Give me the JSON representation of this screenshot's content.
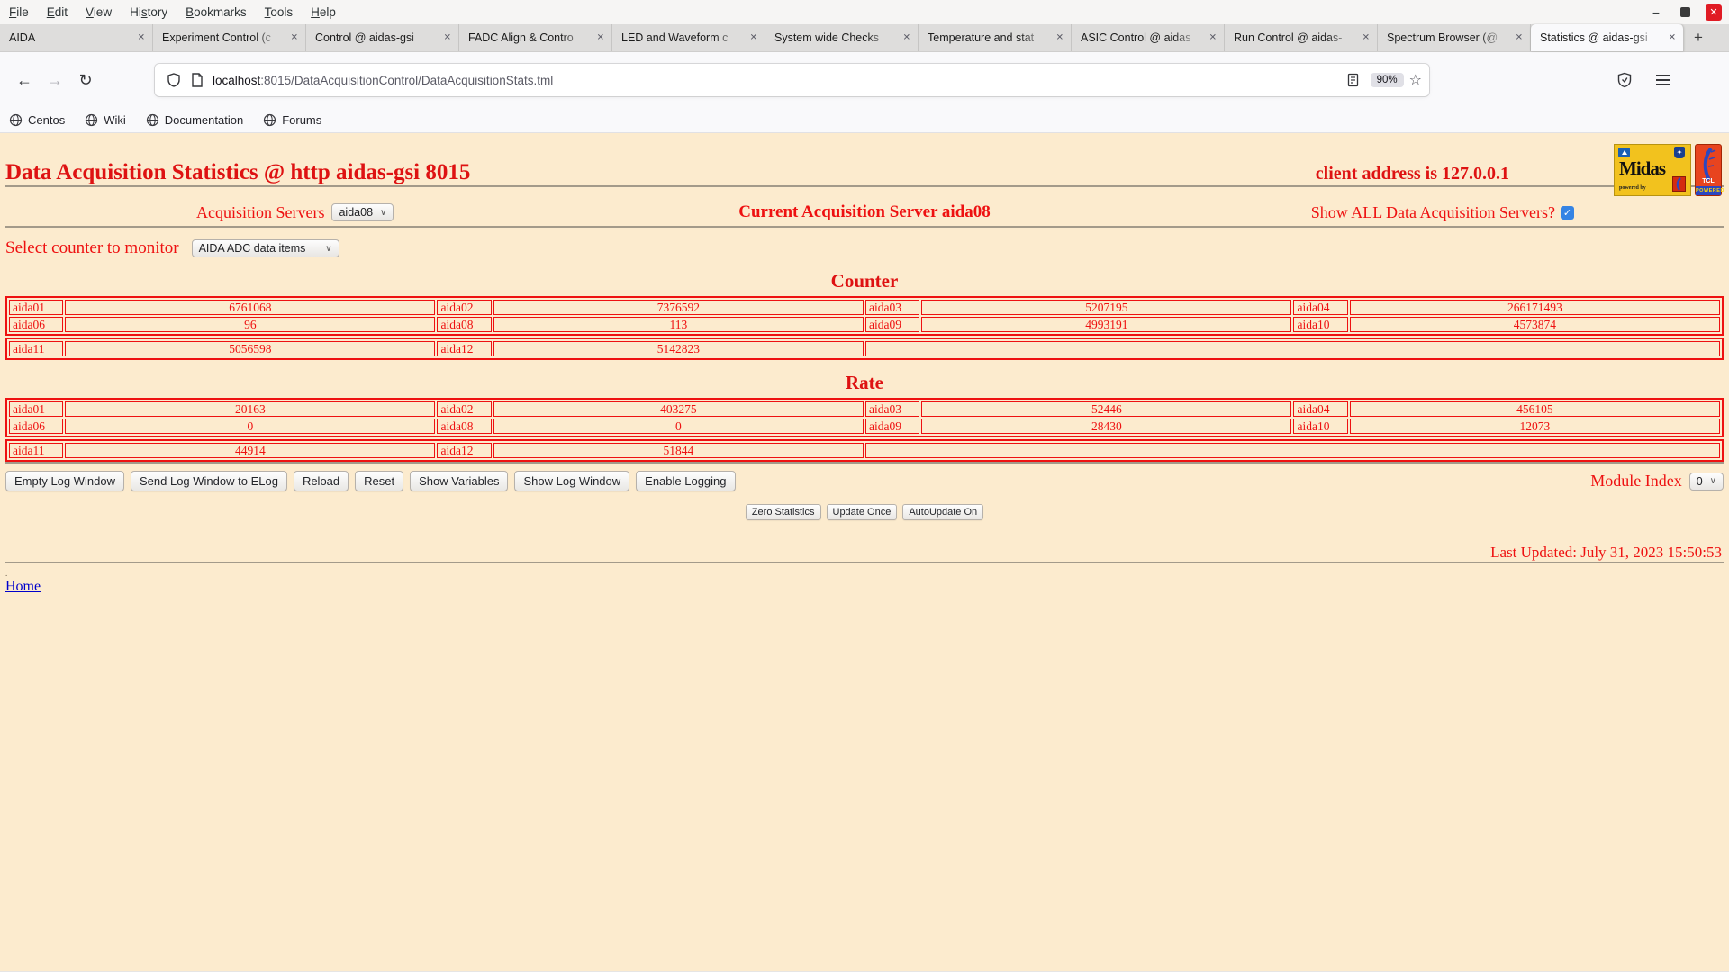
{
  "window": {
    "menu_items": [
      {
        "label": "File",
        "accel": 0
      },
      {
        "label": "Edit",
        "accel": 0
      },
      {
        "label": "View",
        "accel": 0
      },
      {
        "label": "History",
        "accel": 2
      },
      {
        "label": "Bookmarks",
        "accel": 0
      },
      {
        "label": "Tools",
        "accel": 0
      },
      {
        "label": "Help",
        "accel": 0
      }
    ],
    "controls": {
      "minimize": "−",
      "close": "✕"
    }
  },
  "tabs": {
    "items": [
      {
        "label": "AIDA",
        "active": false
      },
      {
        "label": "Experiment Control (c",
        "active": false
      },
      {
        "label": "Control @ aidas-gsi",
        "active": false
      },
      {
        "label": "FADC Align & Contro",
        "active": false
      },
      {
        "label": "LED and Waveform c",
        "active": false
      },
      {
        "label": "System wide Checks",
        "active": false
      },
      {
        "label": "Temperature and stat",
        "active": false
      },
      {
        "label": "ASIC Control @ aidas",
        "active": false
      },
      {
        "label": "Run Control @ aidas-",
        "active": false
      },
      {
        "label": "Spectrum Browser (@",
        "active": false
      },
      {
        "label": "Statistics @ aidas-gsi",
        "active": true
      }
    ],
    "new_tab_label": "+",
    "close_glyph": "✕"
  },
  "toolbar": {
    "back_glyph": "←",
    "forward_glyph": "→",
    "reload_glyph": "↻",
    "url_host": "localhost",
    "url_rest": ":8015/DataAcquisitionControl/DataAcquisitionStats.tml",
    "zoom_level": "90%",
    "star_glyph": "☆"
  },
  "bookmarks": {
    "items": [
      "Centos",
      "Wiki",
      "Documentation",
      "Forums"
    ]
  },
  "page": {
    "title": "Data Acquisition Statistics @ http aidas-gsi 8015",
    "client_address": "client address is 127.0.0.1",
    "server_row": {
      "label": "Acquisition Servers",
      "selected_server": "aida08",
      "current": "Current Acquisition Server aida08",
      "show_all_label": "Show ALL Data Acquisition Servers?",
      "show_all_checked": true,
      "check_glyph": "✓"
    },
    "counter_select": {
      "label": "Select counter to monitor",
      "value": "AIDA ADC data items"
    },
    "select_chevron": "∨",
    "counter": {
      "heading": "Counter",
      "rows": [
        [
          [
            "aida01",
            "6761068"
          ],
          [
            "aida02",
            "7376592"
          ],
          [
            "aida03",
            "5207195"
          ],
          [
            "aida04",
            "266171493"
          ]
        ],
        [
          [
            "aida06",
            "96"
          ],
          [
            "aida08",
            "113"
          ],
          [
            "aida09",
            "4993191"
          ],
          [
            "aida10",
            "4573874"
          ]
        ],
        [
          [
            "aida11",
            "5056598"
          ],
          [
            "aida12",
            "5142823"
          ]
        ]
      ]
    },
    "rate": {
      "heading": "Rate",
      "rows": [
        [
          [
            "aida01",
            "20163"
          ],
          [
            "aida02",
            "403275"
          ],
          [
            "aida03",
            "52446"
          ],
          [
            "aida04",
            "456105"
          ]
        ],
        [
          [
            "aida06",
            "0"
          ],
          [
            "aida08",
            "0"
          ],
          [
            "aida09",
            "28430"
          ],
          [
            "aida10",
            "12073"
          ]
        ],
        [
          [
            "aida11",
            "44914"
          ],
          [
            "aida12",
            "51844"
          ]
        ]
      ]
    },
    "log_buttons": [
      "Empty Log Window",
      "Send Log Window to ELog",
      "Reload",
      "Reset",
      "Show Variables",
      "Show Log Window",
      "Enable Logging"
    ],
    "module_index": {
      "label": "Module Index",
      "value": "0"
    },
    "update_buttons": [
      "Zero Statistics",
      "Update Once",
      "AutoUpdate On"
    ],
    "last_updated": "Last Updated: July 31, 2023 15:50:53",
    "footer_dot": ".",
    "home_link": "Home",
    "logos": {
      "midas_text": "Midas",
      "midas_sub": "powered by",
      "crest_glyph": "✦",
      "tcl_text": "TCL",
      "tcl_sub": "POWERED"
    }
  },
  "colors": {
    "page_bg": "#FCEBCE",
    "accent_red": "#DE1212",
    "label_red": "#EE1111",
    "link_blue": "#0000CC",
    "checkbox_blue": "#3584E4",
    "close_red": "#E01B24"
  }
}
